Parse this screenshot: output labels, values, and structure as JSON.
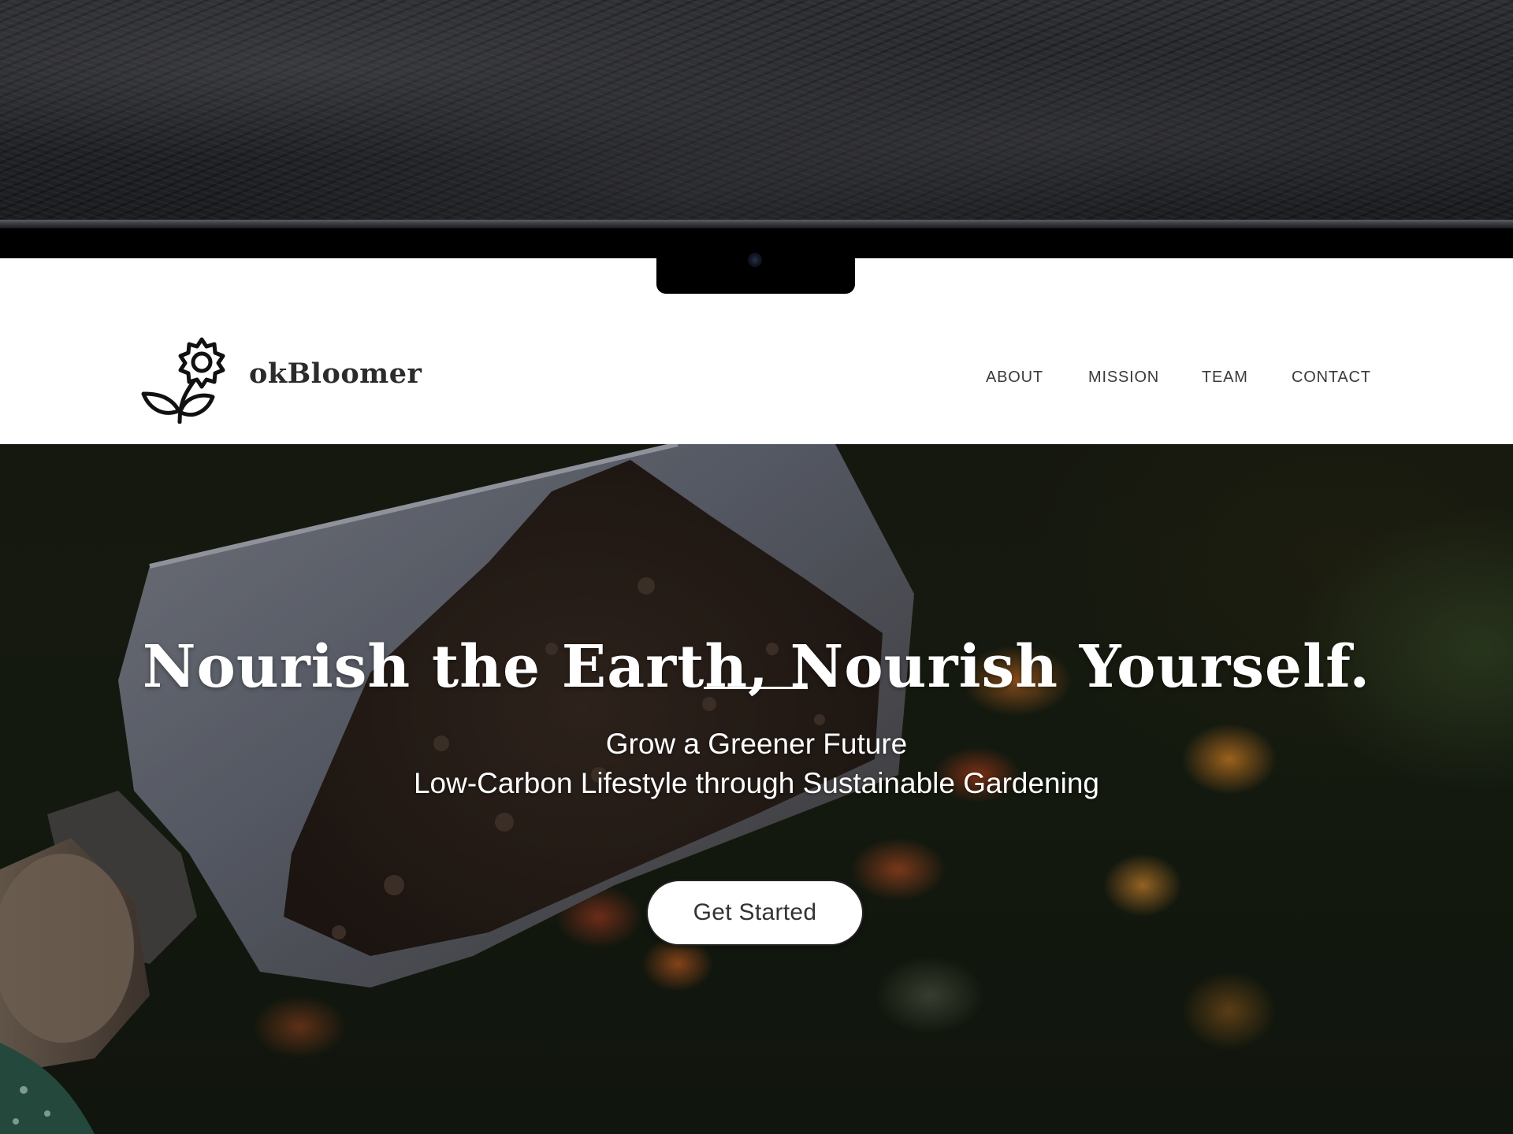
{
  "site": {
    "brand_name": "okBloomer",
    "logo_icon": "flower-icon"
  },
  "nav": {
    "items": [
      {
        "label": "ABOUT"
      },
      {
        "label": "MISSION"
      },
      {
        "label": "TEAM"
      },
      {
        "label": "CONTACT"
      }
    ]
  },
  "hero": {
    "title": "Nourish the Earth, Nourish Yourself.",
    "subtitle_line1": "Grow a Greener Future",
    "subtitle_line2": "Low-Carbon Lifestyle through Sustainable Gardening",
    "cta_label": "Get Started"
  },
  "colors": {
    "header_bg": "#ffffff",
    "text_dark": "#2b2b2b",
    "hero_text": "#ffffff",
    "cta_bg": "#ffffff",
    "cta_text": "#333333"
  }
}
